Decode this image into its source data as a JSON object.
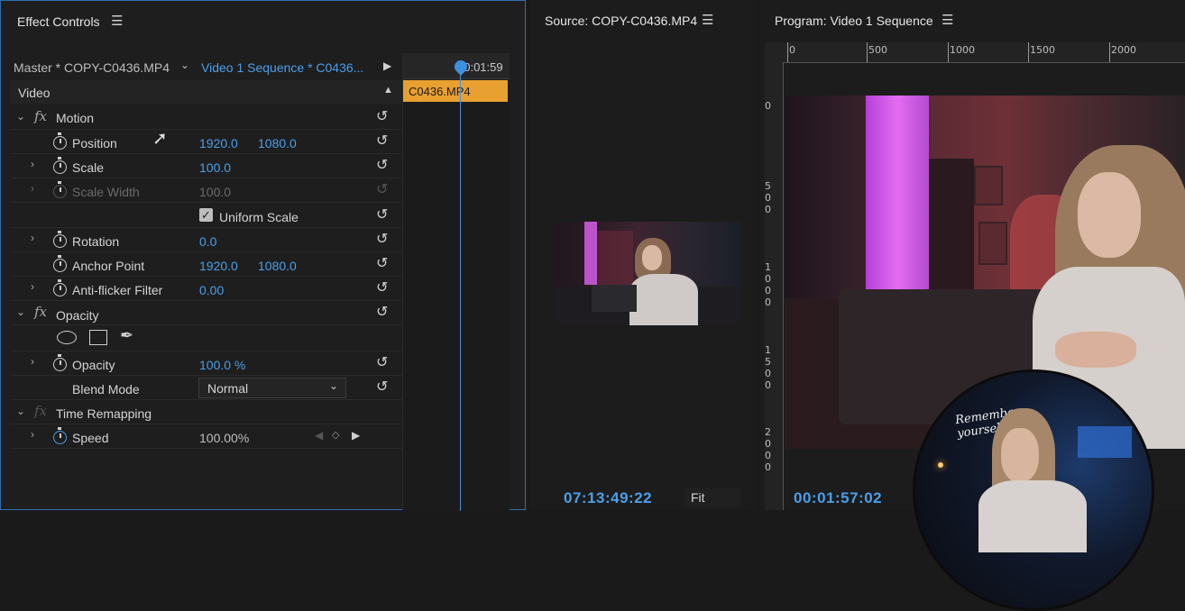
{
  "effect_controls": {
    "title": "Effect Controls",
    "master_label": "Master * COPY-C0436.MP4",
    "sequence_label": "Video 1 Sequence * C0436...",
    "timeline_time": "00:01:59",
    "clip_name": "C0436.MP4",
    "section": "Video",
    "motion": {
      "label": "Motion",
      "position": {
        "label": "Position",
        "x": "1920.0",
        "y": "1080.0"
      },
      "scale": {
        "label": "Scale",
        "value": "100.0"
      },
      "scale_width": {
        "label": "Scale Width",
        "value": "100.0"
      },
      "uniform_scale": {
        "label": "Uniform Scale",
        "checked": true
      },
      "rotation": {
        "label": "Rotation",
        "value": "0.0"
      },
      "anchor_point": {
        "label": "Anchor Point",
        "x": "1920.0",
        "y": "1080.0"
      },
      "anti_flicker": {
        "label": "Anti-flicker Filter",
        "value": "0.00"
      }
    },
    "opacity": {
      "label": "Opacity",
      "opacity_row": {
        "label": "Opacity",
        "value": "100.0 %"
      },
      "blend_mode": {
        "label": "Blend Mode",
        "value": "Normal"
      }
    },
    "time_remapping": {
      "label": "Time Remapping",
      "speed": {
        "label": "Speed",
        "value": "100.00%"
      }
    }
  },
  "source_monitor": {
    "title": "Source: COPY-C0436.MP4",
    "timecode": "07:13:49:22",
    "zoom": "Fit"
  },
  "program_monitor": {
    "title": "Program: Video 1 Sequence",
    "timecode": "00:01:57:02",
    "ruler_top": [
      "0",
      "500",
      "1000",
      "1500",
      "2000"
    ],
    "ruler_left": [
      "0",
      "500",
      "1000",
      "1500",
      "2000"
    ],
    "overlay_text": "Remember yourself"
  },
  "colors": {
    "accent": "#4a9fea",
    "clip": "#e8a030",
    "panel_border": "#2f6fb0"
  }
}
